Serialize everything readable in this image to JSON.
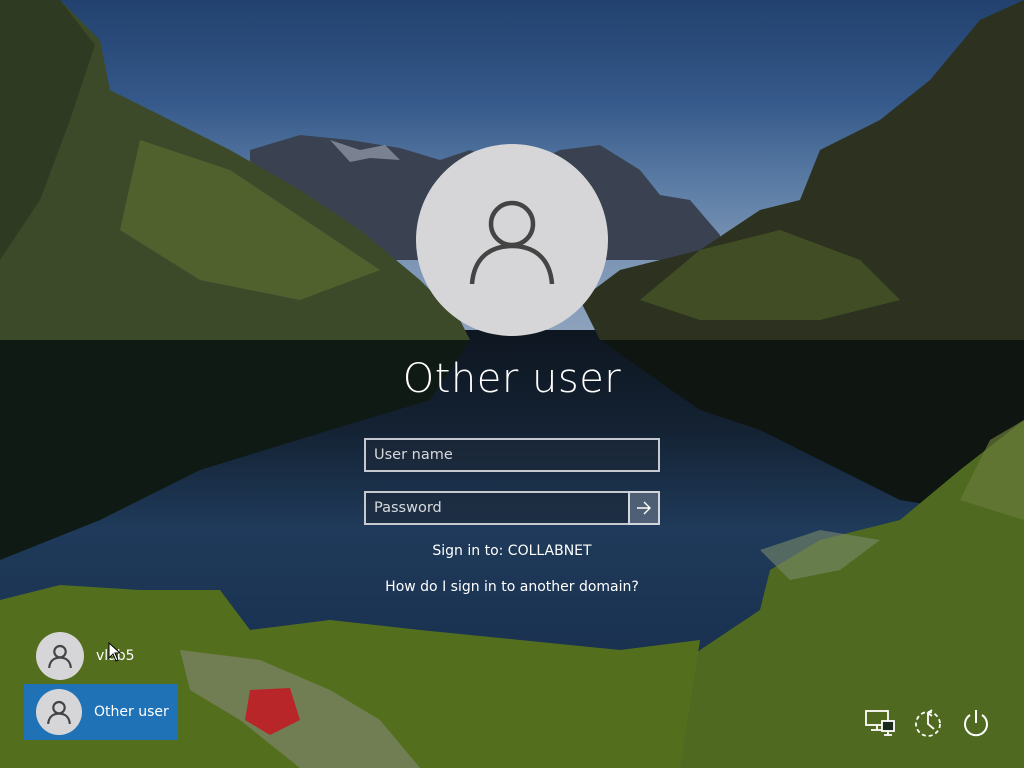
{
  "login": {
    "title": "Other user",
    "username_placeholder": "User name",
    "password_placeholder": "Password",
    "signin_to": "Sign in to: COLLABNET",
    "help_link": "How do I sign in to another domain?"
  },
  "users": [
    {
      "name": "vlab5"
    },
    {
      "name": "Other user",
      "selected": true
    }
  ],
  "icons": {
    "network": "network-icon",
    "ease_of_access": "ease-of-access-icon",
    "power": "power-icon",
    "submit": "arrow-right-icon",
    "avatar": "person-icon"
  },
  "colors": {
    "selected_tile": "#1f72b5",
    "avatar_bg": "#d6d6d8"
  }
}
